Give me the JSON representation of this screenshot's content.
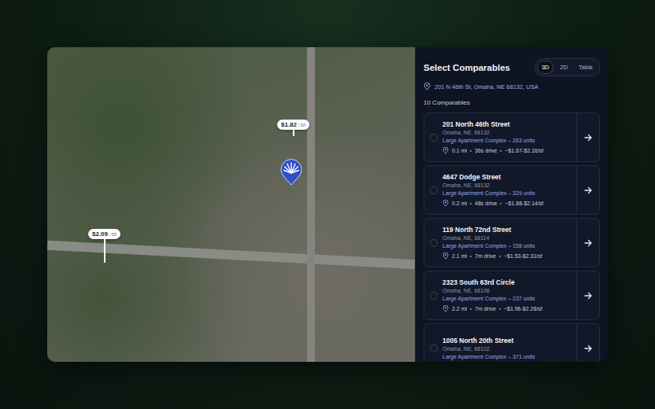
{
  "map": {
    "pins": [
      {
        "price": "$1.82",
        "unit": "/ SF"
      },
      {
        "price": "$2.09",
        "unit": "/ SF"
      }
    ]
  },
  "panel": {
    "title": "Select Comparables",
    "views": [
      {
        "label": "3D",
        "selected": true
      },
      {
        "label": "2D",
        "selected": false
      },
      {
        "label": "Table",
        "selected": false
      }
    ],
    "address": "201 N 46th St, Omaha, NE 68132, USA",
    "count": "10 Comparables",
    "comparables": [
      {
        "name": "201 North 46th Street",
        "city": "Omaha, NE, 68132",
        "type": "Large Apartment Complex – 283 units",
        "selected": false,
        "distance": "0.1 mi",
        "drive": "36s drive",
        "rent": "~$1.67-$2.16/sf"
      },
      {
        "name": "4647 Dodge Street",
        "city": "Omaha, NE, 68132",
        "type": "Large Apartment Complex – 329 units",
        "selected": false,
        "distance": "0.2 mi",
        "drive": "48s drive",
        "rent": "~$1.88-$2.14/sf"
      },
      {
        "name": "119 North 72nd Street",
        "city": "Omaha, NE, 68114",
        "type": "Large Apartment Complex – 158 units",
        "selected": false,
        "distance": "2.1 mi",
        "drive": "7m drive",
        "rent": "~$1.53-$2.31/sf"
      },
      {
        "name": "2323 South 63rd Circle",
        "city": "Omaha, NE, 68106",
        "type": "Large Apartment Complex – 237 units",
        "selected": false,
        "distance": "2.2 mi",
        "drive": "7m drive",
        "rent": "~$1.96-$2.28/sf"
      },
      {
        "name": "1005 North 20th Street",
        "city": "Omaha, NE, 68102",
        "type": "Large Apartment Complex – 371 units",
        "selected": false
      }
    ]
  }
}
